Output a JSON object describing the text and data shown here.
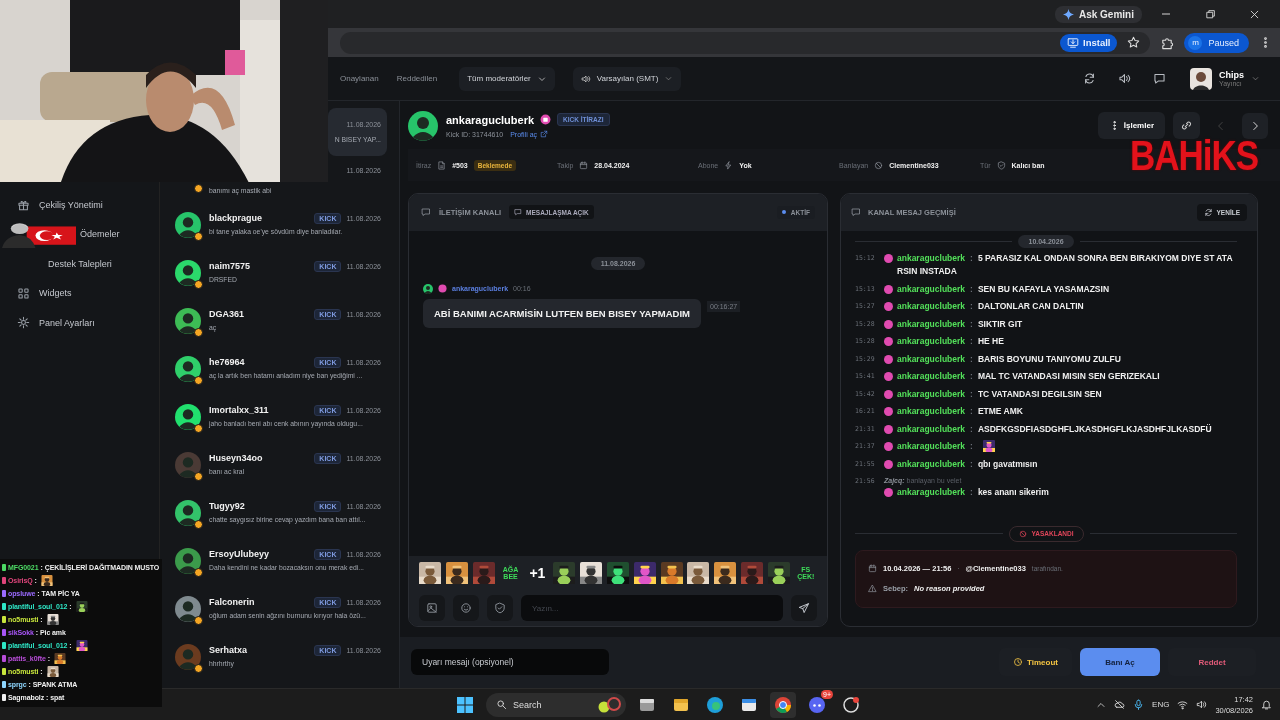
{
  "browser": {
    "ask_button": "Ask Gemini",
    "install_button": "Install",
    "profile": {
      "initial": "m",
      "label": "Paused"
    }
  },
  "header": {
    "tabs": [
      {
        "label": "Onaylanan",
        "selected": false
      },
      {
        "label": "Reddedilen",
        "selected": false
      }
    ],
    "moderator_filter": "Tüm moderatörler",
    "sound_filter": "Varsayılan (SMT)",
    "user": {
      "name": "Chips",
      "role": "Yayıncı"
    }
  },
  "sidebar": {
    "items": [
      {
        "label": "Çekiliş Yönetimi",
        "kind": "gift"
      },
      {
        "label": "Ödemeler",
        "kind": "hidden"
      },
      {
        "label": "Destek Talepleri",
        "kind": "hidden"
      },
      {
        "label": "Widgets",
        "kind": "grid"
      },
      {
        "label": "Panel Ayarları",
        "kind": "gear"
      }
    ]
  },
  "appeals": [
    {
      "message": "N BISEY YAP...",
      "date": "11.08.2026",
      "selected": true
    },
    {
      "message": "banımı aç mastik abi",
      "date": "11.08.2026",
      "selected": false
    },
    {
      "name": "blackprague",
      "tag": "KICK",
      "date": "11.08.2026",
      "message": "bi tane yalaka oe'ye sövdüm diye banladılar.",
      "selected": false
    },
    {
      "name": "naim7575",
      "tag": "KICK",
      "date": "11.08.2026",
      "message": "DRSFED",
      "selected": false
    },
    {
      "name": "DGA361",
      "tag": "KICK",
      "date": "11.08.2026",
      "message": "aç",
      "selected": false
    },
    {
      "name": "he76964",
      "tag": "KICK",
      "date": "11.08.2026",
      "message": "aç la artık ben hatamı anladım niye ban yediğimi ...",
      "selected": false
    },
    {
      "name": "Imortalxx_311",
      "tag": "KICK",
      "date": "11.08.2026",
      "message": "jaho banladı beni abı cenk abının yayında oldugu...",
      "selected": false
    },
    {
      "name": "Huseyn34oo",
      "tag": "KICK",
      "date": "11.08.2026",
      "message": "banı ac kral",
      "selected": false
    },
    {
      "name": "Tugyy92",
      "tag": "KICK",
      "date": "11.08.2026",
      "message": "chatte saygısız birine cevap yazdım bana ban attıl...",
      "selected": false
    },
    {
      "name": "ErsoyUlubeyy",
      "tag": "KICK",
      "date": "11.08.2026",
      "message": "Daha kendini ne kadar bozacaksın onu merak edi...",
      "selected": false
    },
    {
      "name": "Falconerin",
      "tag": "KICK",
      "date": "11.08.2026",
      "message": "oğlum adam senin ağzını burnunu kırıyor hala özü...",
      "selected": false
    },
    {
      "name": "Serhatxa",
      "tag": "KICK",
      "date": "11.08.2026",
      "message": "hhrhrthy",
      "selected": false
    }
  ],
  "detail": {
    "username": "ankaragucluberk",
    "tag": "KICK İTİRAZI",
    "kick_id": "Kick ID: 31744610",
    "profile_link": "Profili aç",
    "actions_button": "İşlemler",
    "prev": {
      "disabled": true
    },
    "next": {
      "disabled": false
    },
    "fields": [
      {
        "label": "İtiraz",
        "kind": "file",
        "value": "#503",
        "badge": "Beklemede"
      },
      {
        "label": "Takip",
        "kind": "calendar",
        "value": "28.04.2024"
      },
      {
        "label": "Abone",
        "kind": "bolt",
        "value": "Yok"
      },
      {
        "label": "Banlayan",
        "kind": "ban",
        "value": "Clementine033"
      },
      {
        "label": "Tür",
        "kind": "shield",
        "value": "Kalıcı ban"
      }
    ]
  },
  "chat_panel": {
    "title": "İLETİŞİM KANALI",
    "mode_tag": "MESAJLAŞMA AÇIK",
    "status": "AKTİF",
    "date_chip": "11.08.2026",
    "message": {
      "name": "ankaragucluberk",
      "time": "00:16",
      "text": "ABİ BANIMI ACARMİSİN LUTFEN BEN BISEY YAPMADIM",
      "read_time": "00:16:27"
    },
    "emotes": [
      {
        "kind": "picture"
      },
      {
        "kind": "picture"
      },
      {
        "kind": "picture"
      },
      {
        "kind": "text",
        "text": "AĞA BEE"
      },
      {
        "kind": "text",
        "text": "+1"
      },
      {
        "kind": "picture"
      },
      {
        "kind": "picture"
      },
      {
        "kind": "picture"
      },
      {
        "kind": "picture"
      },
      {
        "kind": "picture"
      },
      {
        "kind": "picture"
      },
      {
        "kind": "picture"
      },
      {
        "kind": "picture"
      },
      {
        "kind": "picture"
      },
      {
        "kind": "text",
        "text": "FS ÇEK!"
      }
    ],
    "input_placeholder": "Yazın..."
  },
  "history_panel": {
    "title": "KANAL MESAJ GEÇMİŞİ",
    "refresh_button": "YENİLE",
    "date_chip": "10.04.2026",
    "separator": ":",
    "rows": [
      {
        "time": "15:12",
        "name": "ankaragucluberk",
        "kind": "text",
        "text": "5 PARASIZ KAL ONDAN SONRA BEN BIRAKIYOM DIYE ST ATA RSIN INSTADA"
      },
      {
        "time": "15:13",
        "name": "ankaragucluberk",
        "kind": "text",
        "text": "SEN BU KAFAYLA YASAMAZSIN"
      },
      {
        "time": "15:27",
        "name": "ankaragucluberk",
        "kind": "text",
        "text": "DALTONLAR CAN DALTIN"
      },
      {
        "time": "15:28",
        "name": "ankaragucluberk",
        "kind": "text",
        "text": "SIKTIR GIT"
      },
      {
        "time": "15:28",
        "name": "ankaragucluberk",
        "kind": "text",
        "text": "HE HE"
      },
      {
        "time": "15:29",
        "name": "ankaragucluberk",
        "kind": "text",
        "text": "BARIS BOYUNU TANIYOMU ZULFU"
      },
      {
        "time": "15:41",
        "name": "ankaragucluberk",
        "kind": "text",
        "text": "MAL TC VATANDASI MISIN SEN GERIZEKALI"
      },
      {
        "time": "15:42",
        "name": "ankaragucluberk",
        "kind": "text",
        "text": "TC VATANDASI DEGILSIN SEN"
      },
      {
        "time": "16:21",
        "name": "ankaragucluberk",
        "kind": "text",
        "text": "ETME AMK"
      },
      {
        "time": "21:31",
        "name": "ankaragucluberk",
        "kind": "text",
        "text": "ASDFKGSDFIASDGHFLJKASDHGFLKJASDHFJLKASDFÜ"
      },
      {
        "time": "21:37",
        "name": "ankaragucluberk",
        "kind": "emote"
      },
      {
        "time": "21:55",
        "name": "ankaragucluberk",
        "kind": "text",
        "text": "qbı gavatmısın"
      },
      {
        "time": "21:56",
        "name": "ankaragucluberk",
        "kind": "text",
        "text": "kes ananı sikerim",
        "reply": "**Zajcq:** banlayan bu velet"
      }
    ],
    "ban_label": "YASAKLANDI",
    "ban_date": "10.04.2026 — 21:56",
    "ban_dot": "·",
    "ban_by": "@Clementine033",
    "ban_by_suffix": "tarafından.",
    "reason_label": "Sebep:",
    "reason": "No reason provided"
  },
  "action_bar": {
    "warning_placeholder": "Uyarı mesajı (opsiyonel)",
    "timeout_button": "Timeout",
    "unban_button": "Banı Aç",
    "reject_button": "Reddet"
  },
  "taskbar": {
    "search_placeholder": "Search",
    "language": "ENG",
    "time": "17:42",
    "date": "30/08/2026",
    "discord_badge": "9+"
  },
  "overlay": {
    "logo": "BAHiKS",
    "separator": ":",
    "chat": [
      {
        "name": "MFG0021",
        "color": "#4cd964",
        "kind": "text",
        "text": "ÇEKİLİŞLERİ DAĞITMADIN MUSTO"
      },
      {
        "name": "OsirisQ",
        "color": "#e0457b",
        "kind": "emote"
      },
      {
        "name": "opsluwe",
        "color": "#9b6bff",
        "kind": "text",
        "text": "TAM PİC YA"
      },
      {
        "name": "plantiful_soul_012",
        "color": "#2ee6c6",
        "kind": "emote"
      },
      {
        "name": "no5musti",
        "color": "#c8e63c",
        "kind": "emote"
      },
      {
        "name": "sikSokk",
        "color": "#a855f7",
        "kind": "text",
        "text": "Pic amk"
      },
      {
        "name": "plantiful_soul_012",
        "color": "#2ee6c6",
        "kind": "emote"
      },
      {
        "name": "pattis_k0fte",
        "color": "#b84dd8",
        "kind": "emote"
      },
      {
        "name": "no5musti",
        "color": "#c8e63c",
        "kind": "emote"
      },
      {
        "name": "sprgc",
        "color": "#8fd7ff",
        "kind": "text",
        "text": "SPANK ATMA"
      },
      {
        "name": "Sagmabolz",
        "color": "#f0f0f0",
        "kind": "text",
        "text": "spat"
      }
    ]
  }
}
